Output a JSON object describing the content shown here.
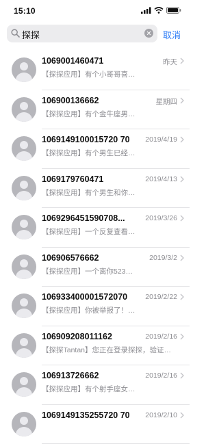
{
  "status_bar": {
    "time": "15:10"
  },
  "search": {
    "query": "探探",
    "cancel_label": "取消"
  },
  "messages": [
    {
      "sender": "1069001460471",
      "date": "昨天",
      "preview": "【探探应用】有个小哥哥喜…"
    },
    {
      "sender": "106900136662",
      "date": "星期四",
      "preview": "【探探应用】有个金牛座男…"
    },
    {
      "sender": "1069149100015720 70",
      "date": "2019/4/19",
      "preview": "【探探应用】有个男生已经…"
    },
    {
      "sender": "1069179760471",
      "date": "2019/4/13",
      "preview": "【探探应用】有个男生和你…"
    },
    {
      "sender": "1069296451590708...",
      "date": "2019/3/26",
      "preview": "【探探应用】一个反复查看…"
    },
    {
      "sender": "106906576662",
      "date": "2019/3/2",
      "preview": "【探探应用】一个离你523…"
    },
    {
      "sender": "106933400001572070",
      "date": "2019/2/22",
      "preview": "【探探应用】你被举报了！…"
    },
    {
      "sender": "106909208011162",
      "date": "2019/2/16",
      "preview": "【探探Tantan】您正在登录探探，验证…"
    },
    {
      "sender": "106913726662",
      "date": "2019/2/16",
      "preview": "【探探应用】有个射手座女…"
    },
    {
      "sender": "1069149135255720 70",
      "date": "2019/2/10",
      "preview": ""
    }
  ]
}
